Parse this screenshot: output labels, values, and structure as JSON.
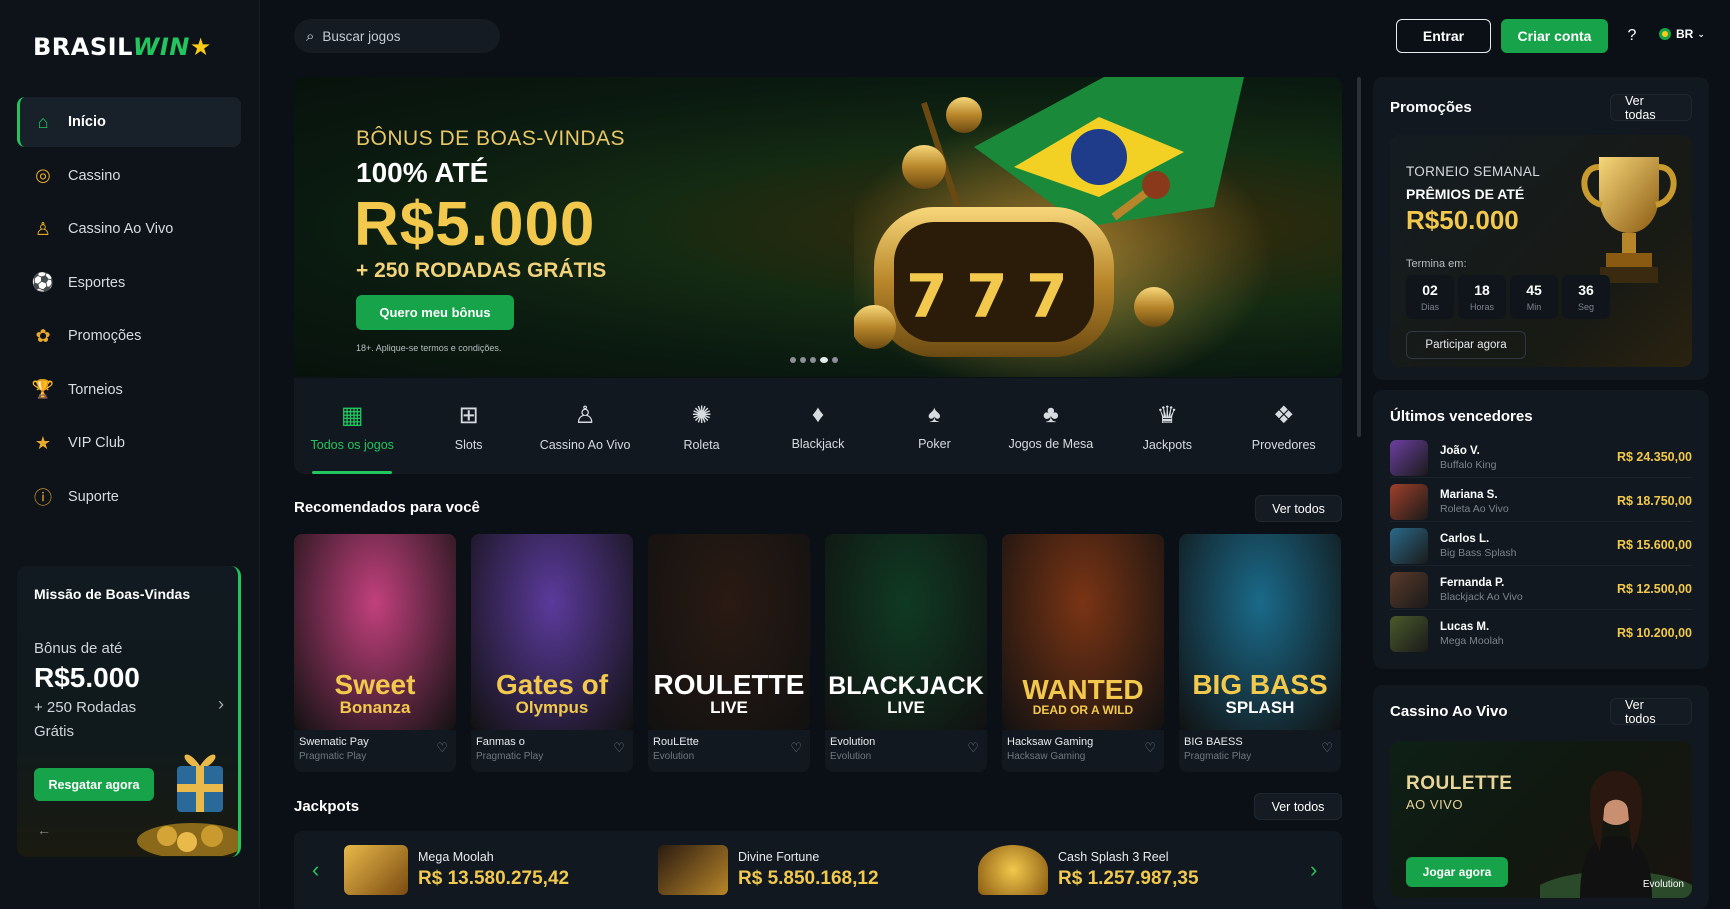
{
  "brand": {
    "part1": "BRASIL",
    "part2": "WIN",
    "star": "★"
  },
  "sidebar": {
    "items": [
      {
        "label": "Início",
        "icon": "home-icon",
        "glyph": "⌂",
        "active": true
      },
      {
        "label": "Cassino",
        "icon": "casino-chip-icon",
        "glyph": "◎"
      },
      {
        "label": "Cassino Ao Vivo",
        "icon": "live-dealer-icon",
        "glyph": "♙"
      },
      {
        "label": "Esportes",
        "icon": "soccer-ball-icon",
        "glyph": "⚽"
      },
      {
        "label": "Promoções",
        "icon": "gift-icon",
        "glyph": "✿"
      },
      {
        "label": "Torneios",
        "icon": "trophy-icon",
        "glyph": "🏆"
      },
      {
        "label": "VIP Club",
        "icon": "vip-star-icon",
        "glyph": "★"
      },
      {
        "label": "Suporte",
        "icon": "support-icon",
        "glyph": "ⓘ"
      }
    ],
    "mission": {
      "title": "Missão de Boas-Vindas",
      "sub": "Bônus de até",
      "amount": "R$5.000",
      "extra": "+ 250 Rodadas Grátis",
      "button": "Resgatar agora"
    }
  },
  "header": {
    "search_placeholder": "Buscar jogos",
    "login": "Entrar",
    "signup": "Criar conta",
    "help": "?",
    "lang": "BR"
  },
  "hero": {
    "kicker": "BÔNUS DE BOAS-VINDAS",
    "line": "100% ATÉ",
    "amount": "R$5.000",
    "spins": "+ 250 RODADAS GRÁTIS",
    "button": "Quero meu bônus",
    "terms": "18+. Aplique-se termos e condições.",
    "slides": 5,
    "active_slide": 3
  },
  "categories": [
    {
      "label": "Todos os jogos",
      "icon": "grid-icon",
      "glyph": "▦",
      "active": true
    },
    {
      "label": "Slots",
      "icon": "slot-machine-icon",
      "glyph": "⊞"
    },
    {
      "label": "Cassino Ao Vivo",
      "icon": "live-dealer-icon",
      "glyph": "♙"
    },
    {
      "label": "Roleta",
      "icon": "roulette-icon",
      "glyph": "✺"
    },
    {
      "label": "Blackjack",
      "icon": "cards-icon",
      "glyph": "♦"
    },
    {
      "label": "Poker",
      "icon": "poker-icon",
      "glyph": "♠"
    },
    {
      "label": "Jogos de Mesa",
      "icon": "table-games-icon",
      "glyph": "♣"
    },
    {
      "label": "Jackpots",
      "icon": "jackpot-icon",
      "glyph": "♛"
    },
    {
      "label": "Provedores",
      "icon": "providers-icon",
      "glyph": "❖"
    }
  ],
  "recommended": {
    "title": "Recomendados para você",
    "see_all": "Ver todos",
    "games": [
      {
        "art_line1": "Sweet",
        "art_line2": "Bonanza",
        "name": "Swematic Pay",
        "provider": "Pragmatic Play",
        "bg": "#c2407d"
      },
      {
        "art_line1": "Gates of",
        "art_line2": "Olympus",
        "name": "Fanmas o",
        "provider": "Pragmatic Play",
        "bg": "#5b3a9c"
      },
      {
        "art_line1": "ROULETTE",
        "art_line2": "LIVE",
        "name": "RouLEtte",
        "provider": "Evolution",
        "bg": "#2a1a12"
      },
      {
        "art_line1": "BLACKJACK",
        "art_line2": "LIVE",
        "name": "Evolution",
        "provider": "Evolution",
        "bg": "#0f3a22"
      },
      {
        "art_line1": "WANTED",
        "art_line2": "DEAD OR A WILD",
        "name": "Hacksaw Gaming",
        "provider": "Hacksaw Gaming",
        "bg": "#7a3414"
      },
      {
        "art_line1": "BIG BASS",
        "art_line2": "SPLASH",
        "name": "BIG BAESS",
        "provider": "Pragmatic Play",
        "bg": "#1a6a8a"
      }
    ]
  },
  "jackpots": {
    "title": "Jackpots",
    "see_all": "Ver todos",
    "items": [
      {
        "name": "Mega Moolah",
        "value": "R$ 13.580.275,42"
      },
      {
        "name": "Divine Fortune",
        "value": "R$ 5.850.168,12"
      },
      {
        "name": "Cash Splash 3 Reel",
        "value": "R$ 1.257.987,35"
      }
    ]
  },
  "promotions": {
    "title": "Promoções",
    "see_all": "Ver todas",
    "kicker": "TORNEIO SEMANAL",
    "sub": "PRÊMIOS DE ATÉ",
    "amount": "R$50.000",
    "ends": "Termina em:",
    "timer": [
      {
        "num": "02",
        "label": "Dias"
      },
      {
        "num": "18",
        "label": "Horas"
      },
      {
        "num": "45",
        "label": "Min"
      },
      {
        "num": "36",
        "label": "Seg"
      }
    ],
    "button": "Participar agora"
  },
  "winners": {
    "title": "Últimos vencedores",
    "items": [
      {
        "name": "João V.",
        "game": "Buffalo King",
        "amount": "R$ 24.350,00",
        "color": "#6b3fa0"
      },
      {
        "name": "Mariana S.",
        "game": "Roleta Ao Vivo",
        "amount": "R$ 18.750,00",
        "color": "#a0402a"
      },
      {
        "name": "Carlos L.",
        "game": "Big Bass Splash",
        "amount": "R$ 15.600,00",
        "color": "#2a6a8a"
      },
      {
        "name": "Fernanda P.",
        "game": "Blackjack Ao Vivo",
        "amount": "R$ 12.500,00",
        "color": "#5a3a2a"
      },
      {
        "name": "Lucas M.",
        "game": "Mega Moolah",
        "amount": "R$ 10.200,00",
        "color": "#4a5a2a"
      }
    ]
  },
  "live_casino": {
    "title": "Cassino Ao Vivo",
    "see_all": "Ver todos",
    "card_title": "ROULETTE",
    "card_sub": "AO VIVO",
    "button": "Jogar agora",
    "brand": "Evolution"
  },
  "colors": {
    "accent": "#22c55e",
    "gold": "#f2c94c",
    "bg": "#0b1016"
  }
}
